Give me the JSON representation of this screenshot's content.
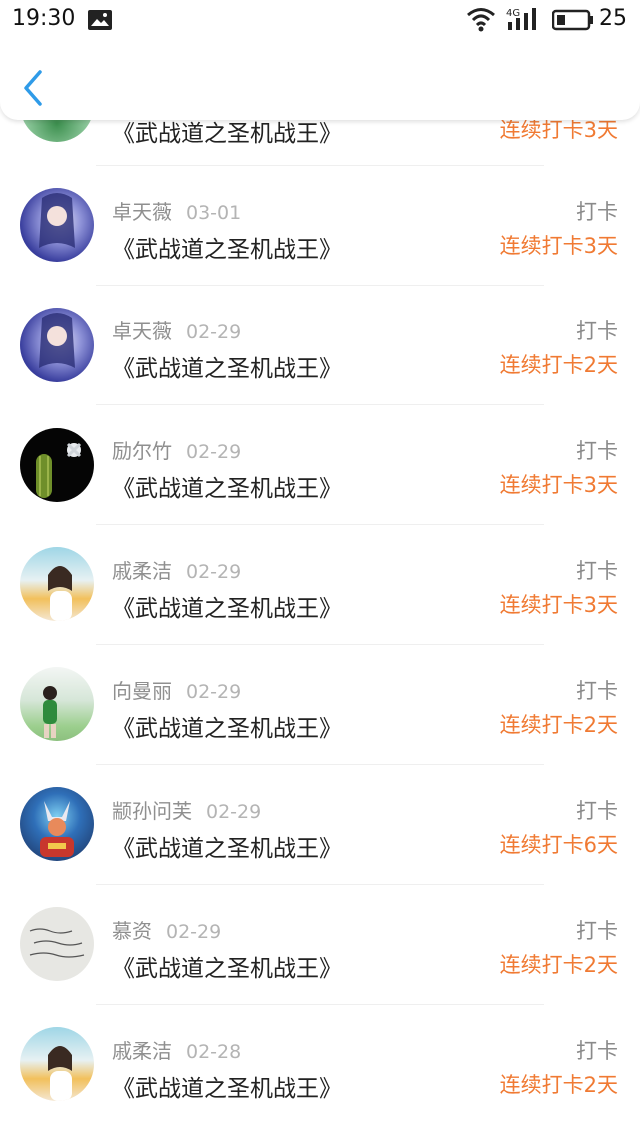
{
  "status_bar": {
    "time": "19:30",
    "network": "4G",
    "battery": "25"
  },
  "list": {
    "book_title": "《武战道之圣机战王》",
    "action_label": "打卡",
    "partial_row": {
      "book": "《武战道之圣机战王》",
      "streak": "连续打卡3天"
    },
    "rows": [
      {
        "name": "卓天薇",
        "date": "03-01",
        "streak": "连续打卡3天",
        "avatar": "anime-girl-avatar"
      },
      {
        "name": "卓天薇",
        "date": "02-29",
        "streak": "连续打卡2天",
        "avatar": "anime-girl-avatar"
      },
      {
        "name": "励尔竹",
        "date": "02-29",
        "streak": "连续打卡3天",
        "avatar": "cactus-avatar"
      },
      {
        "name": "戚柔洁",
        "date": "02-29",
        "streak": "连续打卡3天",
        "avatar": "girl-photo-avatar"
      },
      {
        "name": "向曼丽",
        "date": "02-29",
        "streak": "连续打卡2天",
        "avatar": "person-outdoor-avatar"
      },
      {
        "name": "颛孙问芙",
        "date": "02-29",
        "streak": "连续打卡6天",
        "avatar": "game-character-avatar"
      },
      {
        "name": "慕资",
        "date": "02-29",
        "streak": "连续打卡2天",
        "avatar": "handwriting-avatar"
      },
      {
        "name": "戚柔洁",
        "date": "02-28",
        "streak": "连续打卡2天",
        "avatar": "girl-photo-avatar"
      }
    ]
  },
  "colors": {
    "accent_orange": "#f07a33",
    "back_arrow_blue": "#2f9be8"
  }
}
